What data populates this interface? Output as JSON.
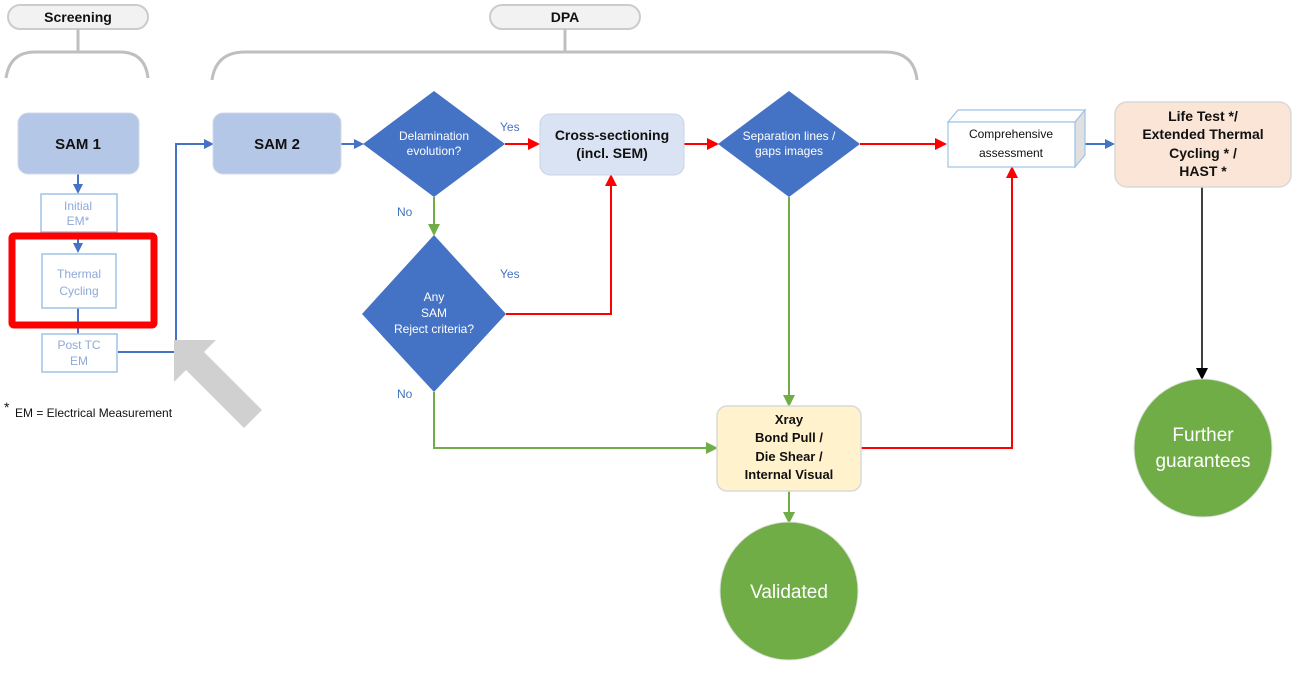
{
  "phases": {
    "screening": "Screening",
    "dpa": "DPA"
  },
  "nodes": {
    "sam1": "SAM 1",
    "initial_em": [
      "Initial",
      "EM*"
    ],
    "thermal_cycling": [
      "Thermal",
      "Cycling"
    ],
    "post_tc_em": [
      "Post TC",
      "EM"
    ],
    "sam2": "SAM 2",
    "delamination": [
      "Delamination",
      "evolution?"
    ],
    "cross_sectioning": [
      "Cross-sectioning",
      "(incl. SEM)"
    ],
    "separation": [
      "Separation lines /",
      "gaps images"
    ],
    "comprehensive": [
      "Comprehensive",
      "assessment"
    ],
    "life_test": [
      "Life Test */",
      "Extended Thermal",
      "Cycling * /",
      "HAST *"
    ],
    "any_sam": [
      "Any",
      "SAM",
      "Reject criteria?"
    ],
    "xray": [
      "Xray",
      "Bond Pull /",
      "Die Shear /",
      "Internal Visual"
    ],
    "validated": "Validated",
    "further": [
      "Further",
      "guarantees"
    ]
  },
  "edge_labels": {
    "delam_yes": "Yes",
    "delam_no": "No",
    "anysam_yes": "Yes",
    "anysam_no": "No"
  },
  "footnote": {
    "star": "*",
    "text": "EM = Electrical Measurement"
  },
  "colors": {
    "blue_box": "#b4c7e7",
    "diamond": "#4472c4",
    "light_box": "#dae3f3",
    "peach": "#fbe5d6",
    "cream": "#fff2cc",
    "green": "#70ad47",
    "red": "#ff0000",
    "highlight": "#ff0000",
    "gray": "#bfbfbf"
  }
}
